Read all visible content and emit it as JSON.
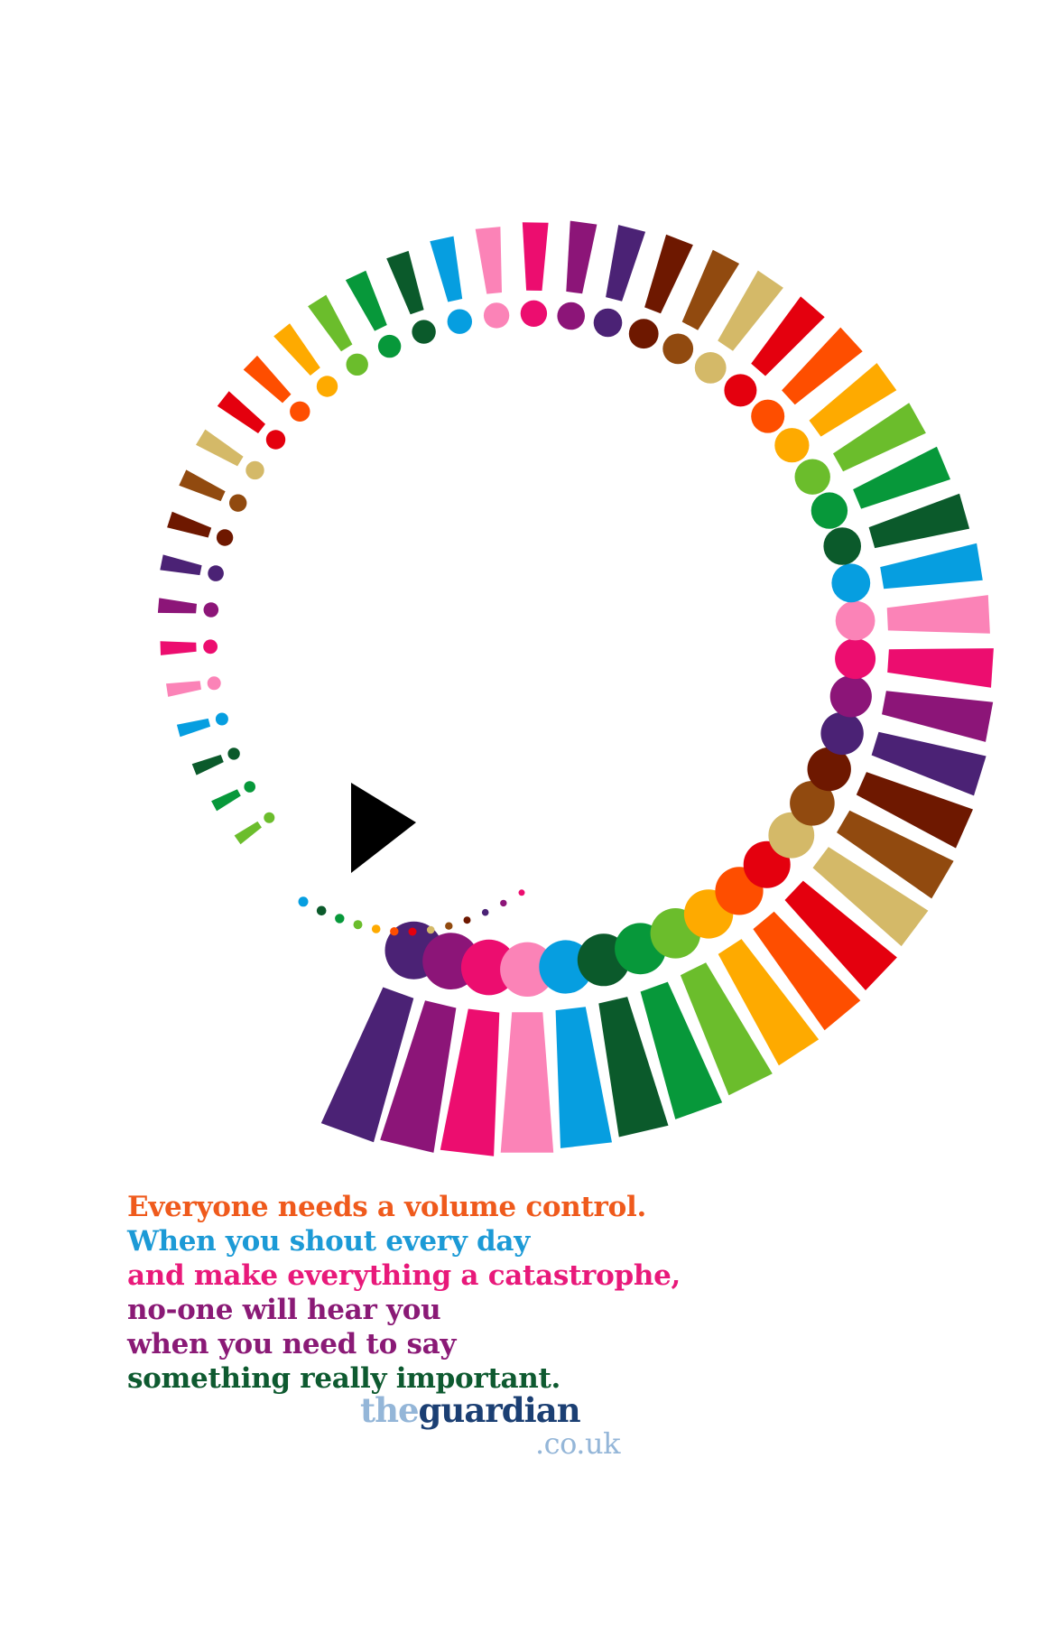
{
  "copy": {
    "lines": [
      {
        "text": "Everyone needs a volume control.",
        "color": "#ef5a1c"
      },
      {
        "text": "When you shout every day",
        "color": "#1c9ad6"
      },
      {
        "text": "and make everything a catastrophe,",
        "color": "#e8197a"
      },
      {
        "text": "no-one will hear you",
        "color": "#8a1a76"
      },
      {
        "text": "when you need to say",
        "color": "#8a1a76"
      },
      {
        "text": "something really important.",
        "color": "#0e5a30"
      }
    ]
  },
  "logo": {
    "the": "the",
    "guardian": "guardian",
    "domain": ".co.uk"
  },
  "icons": {
    "play": "play-icon",
    "spiral": "exclamation-mark-spiral"
  },
  "palette": [
    "#4b2275",
    "#8c1578",
    "#ec0d6f",
    "#fb83b7",
    "#069ee0",
    "#0b5a2b",
    "#07983a",
    "#6bbd2c",
    "#feaa00",
    "#fe4e00",
    "#e4000e",
    "#d4b968",
    "#914a0f",
    "#6e1800"
  ]
}
